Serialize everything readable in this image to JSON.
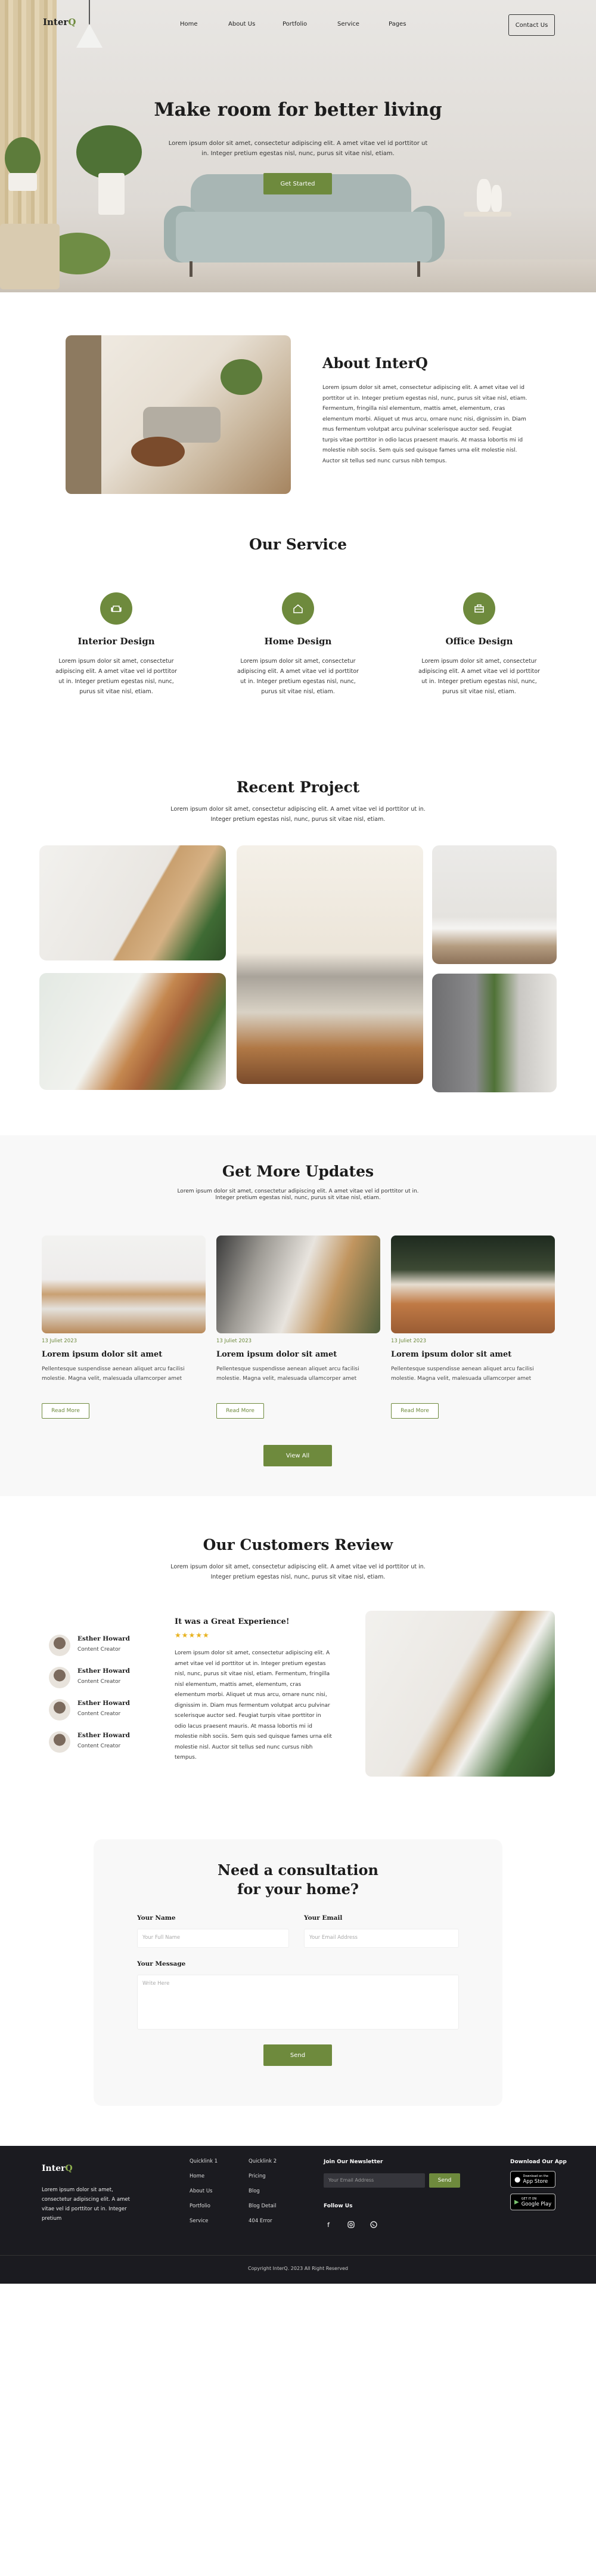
{
  "brand": {
    "logo": "Inter",
    "logo_accent": "Q"
  },
  "nav": {
    "items": [
      "Home",
      "About Us",
      "Portfolio",
      "Service",
      "Pages"
    ],
    "contact": "Contact Us"
  },
  "hero": {
    "title": "Make room for better living",
    "subtitle": "Lorem ipsum dolor sit amet, consectetur adipiscing elit. A amet vitae vel id porttitor ut in. Integer pretium egestas nisl, nunc, purus sit vitae nisl, etiam.",
    "cta": "Get Started"
  },
  "about": {
    "title": "About InterQ",
    "text": "Lorem ipsum dolor sit amet, consectetur adipiscing elit. A amet vitae vel id porttitor ut in. Integer pretium egestas nisl, nunc, purus sit vitae nisl, etiam. Fermentum, fringilla nisl elementum, mattis amet, elementum, cras elementum morbi. Aliquet ut mus arcu, ornare nunc nisi, dignissim in. Diam mus fermentum volutpat arcu pulvinar scelerisque auctor sed. Feugiat turpis vitae porttitor in odio lacus praesent mauris. At massa lobortis mi id molestie nibh sociis. Sem quis sed quisque fames urna elit molestie nisl. Auctor sit tellus sed nunc cursus nibh tempus."
  },
  "services": {
    "title": "Our Service",
    "items": [
      {
        "name": "Interior Design",
        "icon": "sofa-icon",
        "text": "Lorem ipsum dolor sit amet, consectetur adipiscing elit. A amet vitae vel id porttitor ut in. Integer pretium egestas nisl, nunc, purus sit vitae nisl, etiam."
      },
      {
        "name": "Home Design",
        "icon": "home-icon",
        "text": "Lorem ipsum dolor sit amet, consectetur adipiscing elit. A amet vitae vel id porttitor ut in. Integer pretium egestas nisl, nunc, purus sit vitae nisl, etiam."
      },
      {
        "name": "Office Design",
        "icon": "briefcase-icon",
        "text": "Lorem ipsum dolor sit amet, consectetur adipiscing elit. A amet vitae vel id porttitor ut in. Integer pretium egestas nisl, nunc, purus sit vitae nisl, etiam."
      }
    ]
  },
  "projects": {
    "title": "Recent Project",
    "subtitle": "Lorem ipsum dolor sit amet, consectetur adipiscing elit. A amet vitae vel id porttitor ut in. Integer pretium egestas nisl, nunc, purus sit vitae nisl, etiam."
  },
  "updates": {
    "title": "Get More Updates",
    "subtitle": "Lorem ipsum dolor sit amet, consectetur adipiscing elit. A amet vitae vel id porttitor ut in. Integer pretium egestas nisl, nunc, purus sit vitae nisl, etiam.",
    "view_all": "View All",
    "cards": [
      {
        "date": "13 Juliet 2023",
        "title": "Lorem ipsum dolor sit amet",
        "text": "Pellentesque suspendisse aenean aliquet arcu facilisi molestie. Magna velit, malesuada ullamcorper amet",
        "button": "Read More"
      },
      {
        "date": "13 Juliet 2023",
        "title": "Lorem ipsum dolor sit amet",
        "text": "Pellentesque suspendisse aenean aliquet arcu facilisi molestie. Magna velit, malesuada ullamcorper amet",
        "button": "Read More"
      },
      {
        "date": "13 Juliet 2023",
        "title": "Lorem ipsum dolor sit amet",
        "text": "Pellentesque suspendisse aenean aliquet arcu facilisi molestie. Magna velit, malesuada ullamcorper amet",
        "button": "Read More"
      }
    ]
  },
  "reviews": {
    "title": "Our Customers Review",
    "subtitle": "Lorem ipsum dolor sit amet, consectetur adipiscing elit. A amet vitae vel id porttitor ut in. Integer pretium egestas nisl, nunc, purus sit vitae nisl, etiam.",
    "people": [
      {
        "name": "Esther Howard",
        "role": "Content Creator"
      },
      {
        "name": "Esther Howard",
        "role": "Content Creator"
      },
      {
        "name": "Esther Howard",
        "role": "Content Creator"
      },
      {
        "name": "Esther Howard",
        "role": "Content Creator"
      }
    ],
    "quote_title": "It was a Great Experience!",
    "stars": "★★★★★",
    "quote": "Lorem ipsum dolor sit amet, consectetur adipiscing elit. A amet vitae vel id porttitor ut in. Integer pretium egestas nisl, nunc, purus sit vitae nisl, etiam. Fermentum, fringilla nisl elementum, mattis amet, elementum, cras elementum morbi. Aliquet ut mus arcu, ornare nunc nisi, dignissim in. Diam mus fermentum volutpat arcu pulvinar scelerisque auctor sed. Feugiat turpis vitae porttitor in odio lacus praesent mauris. At massa lobortis mi id molestie nibh sociis. Sem quis sed quisque fames urna elit molestie nisl. Auctor sit tellus sed nunc cursus nibh tempus."
  },
  "consult": {
    "title_line1": "Need a consultation",
    "title_line2": "for your home?",
    "name_label": "Your Name",
    "name_placeholder": "Your Full Name",
    "email_label": "Your Email",
    "email_placeholder": "Your Email Address",
    "message_label": "Your Message",
    "message_placeholder": "Write Here",
    "send": "Send"
  },
  "footer": {
    "logo": "Inter",
    "logo_accent": "Q",
    "about": "Lorem ipsum dolor sit amet, consectetur adipiscing elit. A amet vitae vel id porttitor ut in. Integer pretium",
    "col1": [
      "Quicklink 1",
      "Home",
      "About Us",
      "Portfolio",
      "Service"
    ],
    "col2": [
      "Quicklink 2",
      "Pricing",
      "Blog",
      "Blog Detail",
      "404 Error"
    ],
    "newsletter": "Join Our Newsletter",
    "newsletter_placeholder": "Your Email Address",
    "newsletter_send": "Send",
    "follow": "Follow Us",
    "download": "Download Our App",
    "appstore_small": "Download on the",
    "appstore": "App Store",
    "googleplay_small": "GET IT ON",
    "googleplay": "Google Play",
    "copyright": "Copyright InterQ. 2023 All Right Reserved"
  },
  "colors": {
    "accent": "#6e8a3d",
    "dark": "#1b1b20"
  }
}
